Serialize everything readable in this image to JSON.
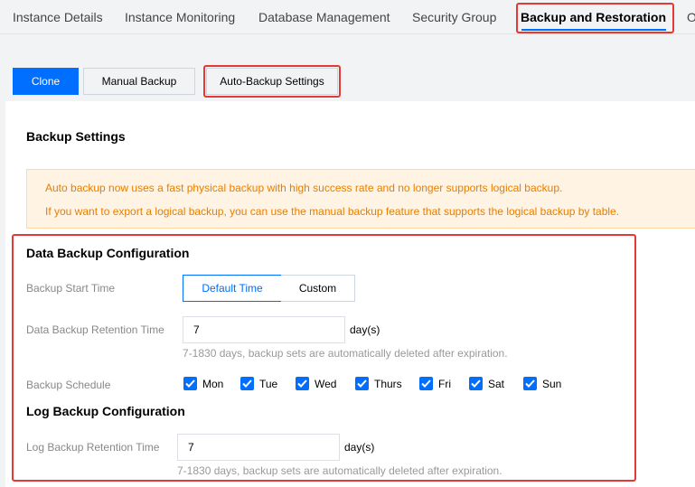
{
  "tabs": [
    {
      "label": "Instance Details"
    },
    {
      "label": "Instance Monitoring"
    },
    {
      "label": "Database Management"
    },
    {
      "label": "Security Group"
    },
    {
      "label": "Backup and Restoration"
    },
    {
      "label": "O"
    }
  ],
  "toolbar": {
    "clone_label": "Clone",
    "manual_backup_label": "Manual Backup",
    "auto_backup_label": "Auto-Backup Settings"
  },
  "dialog": {
    "title": "Backup Settings",
    "notice": [
      "Auto backup now uses a fast physical backup with high success rate and no longer supports logical backup.",
      "If you want to export a logical backup, you can use the manual backup feature that supports the logical backup by table."
    ],
    "data_backup": {
      "title": "Data Backup Configuration",
      "start_time_label": "Backup Start Time",
      "start_time_options": [
        "Default Time",
        "Custom"
      ],
      "retention_label": "Data Backup Retention Time",
      "retention_value": "7",
      "retention_unit": "day(s)",
      "retention_hint": "7-1830 days, backup sets are automatically deleted after expiration.",
      "schedule_label": "Backup Schedule",
      "days": [
        {
          "label": "Mon",
          "checked": true
        },
        {
          "label": "Tue",
          "checked": true
        },
        {
          "label": "Wed",
          "checked": true
        },
        {
          "label": "Thurs",
          "checked": true
        },
        {
          "label": "Fri",
          "checked": true
        },
        {
          "label": "Sat",
          "checked": true
        },
        {
          "label": "Sun",
          "checked": true
        }
      ]
    },
    "log_backup": {
      "title": "Log Backup Configuration",
      "retention_label": "Log Backup Retention Time",
      "retention_value": "7",
      "retention_unit": "day(s)",
      "retention_hint": "7-1830 days, backup sets are automatically deleted after expiration."
    }
  },
  "colors": {
    "accent": "#006eff",
    "highlight_box": "#e53935",
    "notice_text": "#e67e00",
    "notice_bg": "#fff4e3"
  }
}
